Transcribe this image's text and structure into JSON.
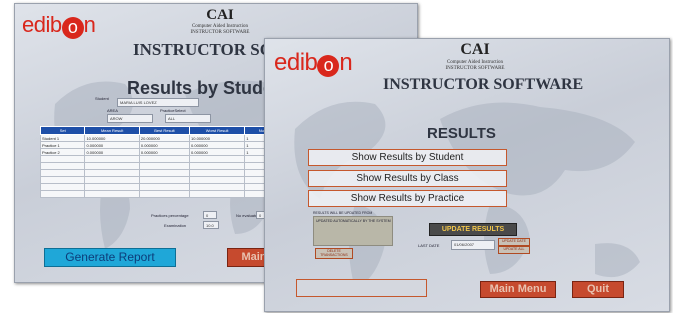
{
  "back_window": {
    "logo": {
      "prefix": "edib",
      "o": "o",
      "suffix": "n"
    },
    "header": {
      "cai": "CAI",
      "subtitle_1": "Computer Aided Instruction",
      "subtitle_2": "INSTRUCTOR SOFTWARE",
      "title": "INSTRUCTOR SOF"
    },
    "page_title": "Results by Studen",
    "filters": {
      "student_label": "Student",
      "student_value": "MARIA LUIS LOVEZ",
      "area_label": "AREA",
      "area_value": "AROW",
      "practice_label": "PracticeSelect",
      "practice_value": "ALL"
    },
    "table": {
      "columns": [
        "Set",
        "Mean Result",
        "Best Result",
        "Worst Result",
        "Num Done",
        "Start Date",
        "Fin"
      ],
      "rows": [
        [
          "Student 1",
          "10.000000",
          "20.000000",
          "10.000000",
          "1",
          "01/06/2007 10:00",
          "01/06/200"
        ],
        [
          "Practice 1",
          "0.000000",
          "0.000000",
          "0.000000",
          "1",
          "01/06/2007 9:50",
          "01/06/200"
        ],
        [
          "Practice 2",
          "0.000000",
          "0.000000",
          "0.000000",
          "1",
          "01/06/2007 9:50",
          "01/06/200"
        ],
        [
          "",
          "",
          "",
          "",
          "",
          "",
          ""
        ],
        [
          "",
          "",
          "",
          "",
          "",
          "",
          ""
        ],
        [
          "",
          "",
          "",
          "",
          "",
          "",
          ""
        ],
        [
          "",
          "",
          "",
          "",
          "",
          "",
          ""
        ],
        [
          "",
          "",
          "",
          "",
          "",
          "",
          ""
        ],
        [
          "",
          "",
          "",
          "",
          "",
          "",
          ""
        ]
      ]
    },
    "stats": {
      "percentage_label": "Practices percentage",
      "percentage_value": "0",
      "evaluated_label": "No evaluated",
      "evaluated_value": "0",
      "examination_label": "Examination",
      "examination_value": "10.0"
    },
    "buttons": {
      "generate_report": "Generate Report",
      "main": "Main"
    }
  },
  "front_window": {
    "logo": {
      "prefix": "edib",
      "o": "o",
      "suffix": "n"
    },
    "header": {
      "cai": "CAI",
      "subtitle_1": "Computer Aided Instruction",
      "subtitle_2": "INSTRUCTOR SOFTWARE",
      "title": "INSTRUCTOR SOFTWARE"
    },
    "page_title": "RESULTS",
    "buttons": {
      "by_student": "Show Results by Student",
      "by_class": "Show Results by Class",
      "by_practice": "Show Results by Practice",
      "update_results": "UPDATE RESULTS",
      "main_menu": "Main Menu",
      "quit": "Quit"
    },
    "update_panel": {
      "caption": "RESULTS WILL BE UPDATED FROM",
      "list_item": "UPDATED AUTOMATICALLY BY THE SYSTEM",
      "small_button": "DELETE TRANSACTIONS",
      "date_label": "LAST DATE",
      "date_value": "01/06/2007",
      "side_button_1": "UPDATE DATE",
      "side_button_2": "UPDATE ALL"
    }
  }
}
